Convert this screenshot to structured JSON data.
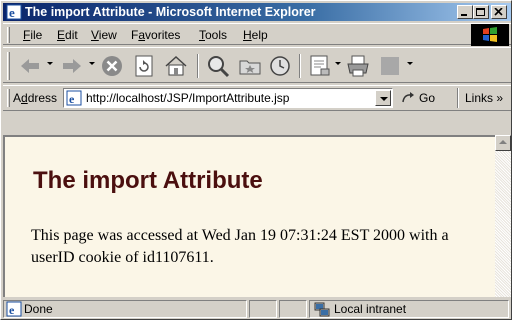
{
  "window": {
    "title": "The import Attribute - Microsoft Internet Explorer",
    "controls": [
      "minimize",
      "maximize",
      "close"
    ]
  },
  "menu": [
    {
      "key": "F",
      "rest": "ile"
    },
    {
      "key": "E",
      "rest": "dit"
    },
    {
      "key": "V",
      "rest": "iew"
    },
    {
      "key": "",
      "pre": "F",
      "ul": "a",
      "post": "vorites"
    },
    {
      "key": "T",
      "rest": "ools"
    },
    {
      "key": "H",
      "rest": "elp"
    }
  ],
  "menu_labels": {
    "file_key": "F",
    "file_rest": "ile",
    "edit_key": "E",
    "edit_rest": "dit",
    "view_key": "V",
    "view_rest": "iew",
    "fav_pre": "F",
    "fav_key": "a",
    "fav_rest": "vorites",
    "tools_key": "T",
    "tools_rest": "ools",
    "help_key": "H",
    "help_rest": "elp"
  },
  "toolbar": {
    "icons": [
      "back-icon",
      "forward-icon",
      "stop-icon",
      "refresh-icon",
      "home-icon",
      "search-icon",
      "favorites-icon",
      "history-icon",
      "mail-icon",
      "print-icon",
      "edit-icon"
    ]
  },
  "address": {
    "label_pre": "A",
    "label_key": "d",
    "label_rest": "dress",
    "url": "http://localhost/JSP/ImportAttribute.jsp",
    "go_label": "Go",
    "links_label": "Links"
  },
  "page": {
    "heading": "The import Attribute",
    "text": "This page was accessed at Wed Jan 19 07:31:24 EST 2000 with a userID cookie of id1107611."
  },
  "status": {
    "text": "Done",
    "zone": "Local intranet"
  },
  "colors": {
    "titlebar_start": "#0a246a",
    "titlebar_end": "#a6caf0",
    "page_background": "#fbf6e7",
    "heading": "#4b0f0f"
  }
}
